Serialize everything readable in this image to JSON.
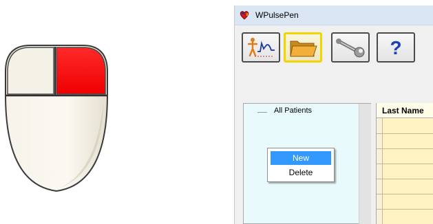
{
  "mouse": {
    "highlighted_button": "right",
    "highlight_color": "#ff0000"
  },
  "window": {
    "title": "WPulsePen",
    "icon": "heart-app-icon"
  },
  "toolbar": {
    "buttons": [
      {
        "icon": "pulse-wave-person-icon"
      },
      {
        "icon": "folder-icon",
        "active": true
      },
      {
        "icon": "wrench-icon"
      },
      {
        "icon": "help-question-icon",
        "label": "?"
      }
    ]
  },
  "patients": {
    "tree_root": "All Patients"
  },
  "grid": {
    "column_header": "Last Name"
  },
  "context_menu": {
    "items": [
      {
        "label": "New",
        "highlighted": true
      },
      {
        "label": "Delete",
        "highlighted": false
      }
    ]
  },
  "colors": {
    "accent": "#3399ff",
    "panel": "#e8fafc",
    "grid": "#fff3c4"
  }
}
